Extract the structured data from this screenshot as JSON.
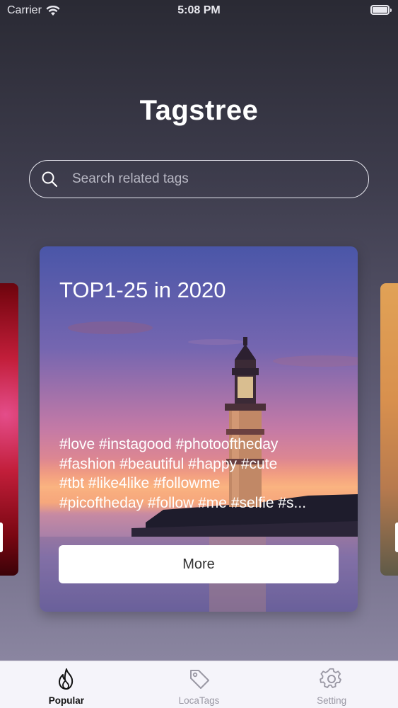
{
  "status_bar": {
    "carrier": "Carrier",
    "time": "5:08 PM"
  },
  "app": {
    "title": "Tagstree"
  },
  "search": {
    "placeholder": "Search related tags"
  },
  "card": {
    "title": "TOP1-25 in 2020",
    "tag_lines": [
      "#love #instagood #photooftheday",
      "#fashion #beautiful #happy #cute",
      "#tbt #like4like #followme",
      "#picoftheday #follow #me #selfie #s..."
    ],
    "more_label": "More"
  },
  "tabs": [
    {
      "label": "Popular",
      "icon": "flame-icon",
      "active": true
    },
    {
      "label": "LocaTags",
      "icon": "tag-icon",
      "active": false
    },
    {
      "label": "Setting",
      "icon": "gear-icon",
      "active": false
    }
  ],
  "colors": {
    "tab_active": "#111111",
    "tab_inactive": "#9a98a4",
    "tabbar_bg": "#f5f4fa"
  }
}
